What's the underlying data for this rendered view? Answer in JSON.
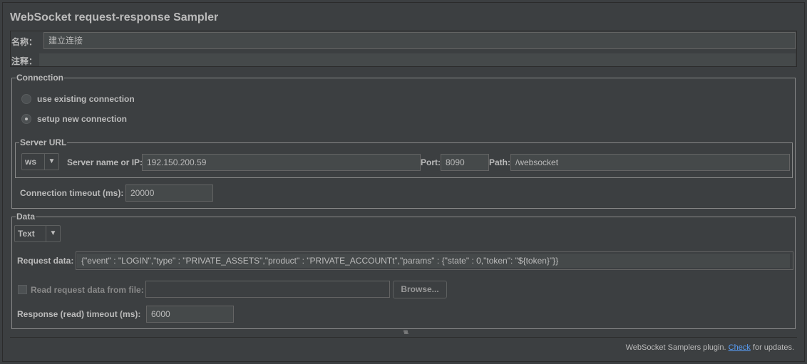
{
  "title": "WebSocket request-response Sampler",
  "name_label": "名称：",
  "name_value": "建立连接",
  "comment_label": "注释：",
  "comment_value": "",
  "connection": {
    "legend": "Connection",
    "use_existing": "use existing connection",
    "setup_new": "setup new connection",
    "selected": "setup new connection",
    "server_url": {
      "legend": "Server URL",
      "protocol": "ws",
      "server_label": "Server name or IP:",
      "server_value": "192.150.200.59",
      "port_label": "Port:",
      "port_value": "8090",
      "path_label": "Path:",
      "path_value": "/websocket"
    },
    "timeout_label": "Connection timeout (ms):",
    "timeout_value": "20000"
  },
  "data": {
    "legend": "Data",
    "type": "Text",
    "request_label": "Request data:",
    "request_value": "{\"event\" : \"LOGIN\",\"type\" : \"PRIVATE_ASSETS\",\"product\" : \"PRIVATE_ACCOUNTt\",\"params\" : {\"state\" : 0,\"token\": \"${token}\"}}",
    "read_file_label": "Read request data from file:",
    "read_file_checked": false,
    "file_value": "",
    "browse_label": "Browse...",
    "response_timeout_label": "Response (read) timeout (ms):",
    "response_timeout_value": "6000"
  },
  "footer": {
    "prefix": "WebSocket Samplers plugin. ",
    "link": "Check",
    "suffix": " for updates."
  },
  "colors": {
    "background": "#3c3f41",
    "field": "#45494a",
    "link": "#589df6"
  }
}
